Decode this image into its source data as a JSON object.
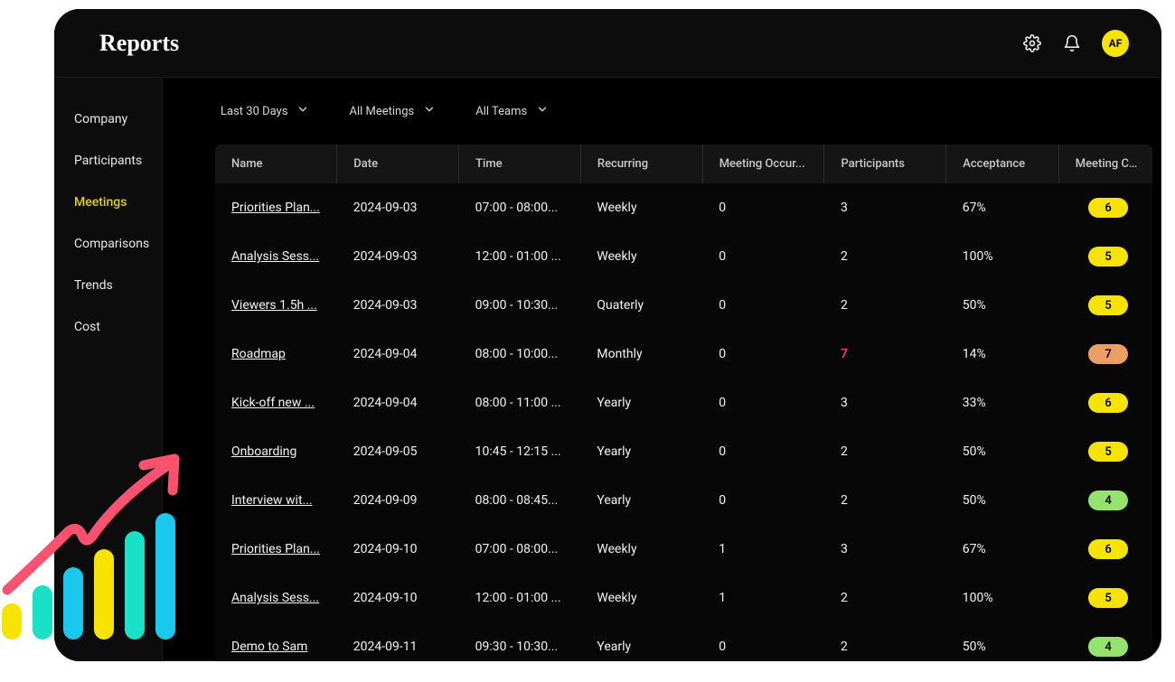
{
  "header": {
    "title": "Reports",
    "avatar_initials": "AF"
  },
  "sidebar": {
    "items": [
      {
        "label": "Company"
      },
      {
        "label": "Participants"
      },
      {
        "label": "Meetings",
        "active": true
      },
      {
        "label": "Comparisons"
      },
      {
        "label": "Trends"
      },
      {
        "label": "Cost"
      }
    ]
  },
  "filters": {
    "date_range": "Last 30 Days",
    "meetings": "All Meetings",
    "teams": "All Teams"
  },
  "table": {
    "columns": {
      "name": "Name",
      "date": "Date",
      "time": "Time",
      "recurring": "Recurring",
      "occurrences": "Meeting Occur...",
      "participants": "Participants",
      "acceptance": "Acceptance",
      "cost": "Meeting Cost I..."
    },
    "rows": [
      {
        "name": "Priorities Plan...",
        "date": "2024-09-03",
        "time": "07:00 - 08:00...",
        "recurring": "Weekly",
        "occ": "0",
        "participants": "3",
        "participants_danger": false,
        "acceptance": "67%",
        "cost": "6",
        "pill": "yellow"
      },
      {
        "name": "Analysis Sess...",
        "date": "2024-09-03",
        "time": "12:00 - 01:00 ...",
        "recurring": "Weekly",
        "occ": "0",
        "participants": "2",
        "participants_danger": false,
        "acceptance": "100%",
        "cost": "5",
        "pill": "yellow"
      },
      {
        "name": "Viewers 1.5h ...",
        "date": "2024-09-03",
        "time": "09:00 - 10:30...",
        "recurring": "Quaterly",
        "occ": "0",
        "participants": "2",
        "participants_danger": false,
        "acceptance": "50%",
        "cost": "5",
        "pill": "yellow"
      },
      {
        "name": "Roadmap",
        "date": "2024-09-04",
        "time": "08:00 - 10:00...",
        "recurring": "Monthly",
        "occ": "0",
        "participants": "7",
        "participants_danger": true,
        "acceptance": "14%",
        "cost": "7",
        "pill": "orange"
      },
      {
        "name": "Kick-off new ...",
        "date": "2024-09-04",
        "time": "08:00 - 11:00 ...",
        "recurring": "Yearly",
        "occ": "0",
        "participants": "3",
        "participants_danger": false,
        "acceptance": "33%",
        "cost": "6",
        "pill": "yellow"
      },
      {
        "name": "Onboarding",
        "date": "2024-09-05",
        "time": "10:45 - 12:15 ...",
        "recurring": "Yearly",
        "occ": "0",
        "participants": "2",
        "participants_danger": false,
        "acceptance": "50%",
        "cost": "5",
        "pill": "yellow"
      },
      {
        "name": "Interview wit...",
        "date": "2024-09-09",
        "time": "08:00 - 08:45...",
        "recurring": "Yearly",
        "occ": "0",
        "participants": "2",
        "participants_danger": false,
        "acceptance": "50%",
        "cost": "4",
        "pill": "green"
      },
      {
        "name": "Priorities Plan...",
        "date": "2024-09-10",
        "time": "07:00 - 08:00...",
        "recurring": "Weekly",
        "occ": "1",
        "participants": "3",
        "participants_danger": false,
        "acceptance": "67%",
        "cost": "6",
        "pill": "yellow"
      },
      {
        "name": "Analysis Sess...",
        "date": "2024-09-10",
        "time": "12:00 - 01:00 ...",
        "recurring": "Weekly",
        "occ": "1",
        "participants": "2",
        "participants_danger": false,
        "acceptance": "100%",
        "cost": "5",
        "pill": "yellow"
      },
      {
        "name": "Demo to Sam",
        "date": "2024-09-11",
        "time": "09:30 - 10:30...",
        "recurring": "Yearly",
        "occ": "0",
        "participants": "2",
        "participants_danger": false,
        "acceptance": "50%",
        "cost": "4",
        "pill": "green"
      }
    ]
  }
}
